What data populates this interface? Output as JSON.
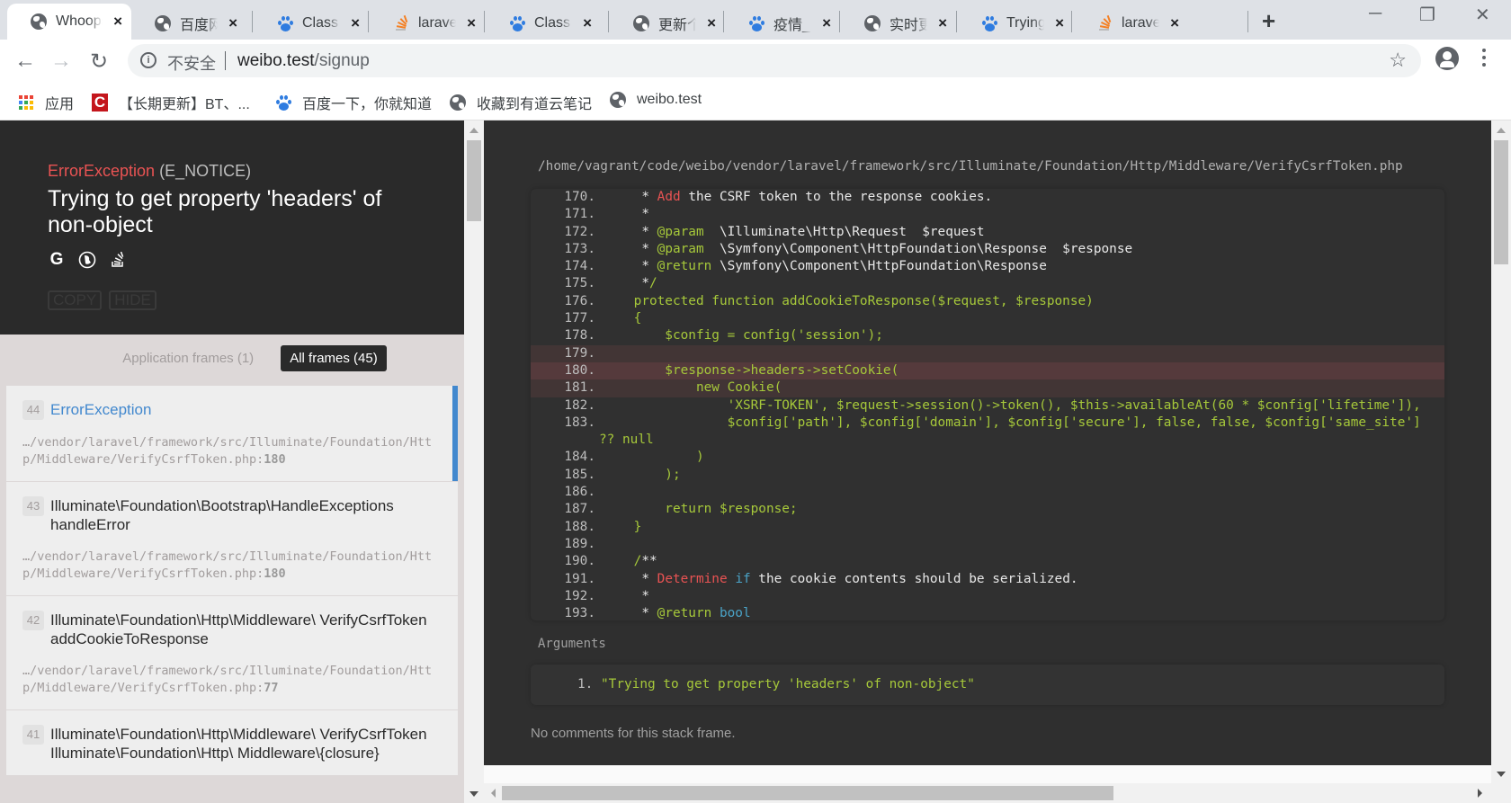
{
  "browser": {
    "tabs": [
      {
        "title": "Whoops! There was an error.",
        "favicon": "globe-icon",
        "active": true
      },
      {
        "title": "百度网盘",
        "favicon": "globe-icon",
        "active": false
      },
      {
        "title": "Class 'A",
        "favicon": "baidu-paw-icon",
        "active": false
      },
      {
        "title": "laravel",
        "favicon": "stackoverflow-icon",
        "active": false
      },
      {
        "title": "Class 'A",
        "favicon": "baidu-paw-icon",
        "active": false
      },
      {
        "title": "更新个人",
        "favicon": "globe-icon",
        "active": false
      },
      {
        "title": "疫情_百",
        "favicon": "baidu-paw-icon",
        "active": false
      },
      {
        "title": "实时更新",
        "favicon": "globe-icon",
        "active": false
      },
      {
        "title": "Trying",
        "favicon": "baidu-paw-icon",
        "active": false
      },
      {
        "title": "laravel",
        "favicon": "stackoverflow-icon",
        "active": false
      }
    ],
    "tab_close": "×",
    "new_tab": "+",
    "window_controls": {
      "minimize": "─",
      "restore": "❐",
      "close": "✕"
    },
    "nav": {
      "back": "←",
      "forward": "→",
      "reload": "↻"
    },
    "omnibox": {
      "security_label": "不安全",
      "host": "weibo.test",
      "path": "/signup",
      "info_glyph": "i"
    },
    "star": "☆",
    "bookmarks": [
      {
        "label": "应用",
        "icon": "apps-grid-icon"
      },
      {
        "label": "【长期更新】BT、...",
        "icon": "c-logo-icon"
      },
      {
        "label": "百度一下，你就知道",
        "icon": "baidu-paw-icon"
      },
      {
        "label": "收藏到有道云笔记",
        "icon": "globe-icon"
      },
      {
        "label": "weibo.test",
        "icon": "globe-icon"
      }
    ]
  },
  "whoops": {
    "exception_class": "ErrorException",
    "exception_code": "(E_NOTICE)",
    "message": "Trying to get property 'headers' of non-object",
    "search_links": [
      {
        "name": "google-search-icon",
        "glyph": "G"
      },
      {
        "name": "duckduckgo-search-icon",
        "glyph": "◐"
      },
      {
        "name": "stackoverflow-search-icon",
        "glyph": "≋"
      }
    ],
    "actions": {
      "copy": "COPY",
      "hide": "HIDE"
    },
    "filters": {
      "application": "Application frames (1)",
      "all": "All frames (45)"
    },
    "frames": [
      {
        "index": "44",
        "class": "ErrorException",
        "file": "…/vendor/laravel/framework/src/Illuminate/Foundation/Http/Middleware/VerifyCsrfToken.php",
        "line": "180",
        "active": true
      },
      {
        "index": "43",
        "class": "Illuminate\\Foundation\\Bootstrap\\HandleExceptions handleError",
        "file": "…/vendor/laravel/framework/src/Illuminate/Foundation/Http/Middleware/VerifyCsrfToken.php",
        "line": "180",
        "active": false
      },
      {
        "index": "42",
        "class": "Illuminate\\Foundation\\Http\\Middleware\\ VerifyCsrfToken addCookieToResponse",
        "file": "…/vendor/laravel/framework/src/Illuminate/Foundation/Http/Middleware/VerifyCsrfToken.php",
        "line": "77",
        "active": false
      },
      {
        "index": "41",
        "class": "Illuminate\\Foundation\\Http\\Middleware\\ VerifyCsrfToken Illuminate\\Foundation\\Http\\ Middleware\\{closure}",
        "file": "",
        "line": "",
        "active": false
      }
    ],
    "file_path": "/home/vagrant/code/weibo/vendor/laravel/framework/src/Illuminate/Foundation/Http/Middleware/VerifyCsrfToken.php",
    "code": [
      {
        "n": "170.",
        "t": "     * Add the CSRF token to the response cookies.",
        "style": "doc-add"
      },
      {
        "n": "171.",
        "t": "     *",
        "style": "doc"
      },
      {
        "n": "172.",
        "t": "     * @param  \\Illuminate\\Http\\Request  $request",
        "style": "doc-at",
        "at": "@param"
      },
      {
        "n": "173.",
        "t": "     * @param  \\Symfony\\Component\\HttpFoundation\\Response  $response",
        "style": "doc-at",
        "at": "@param"
      },
      {
        "n": "174.",
        "t": "     * @return \\Symfony\\Component\\HttpFoundation\\Response",
        "style": "doc-at",
        "at": "@return"
      },
      {
        "n": "175.",
        "t": "     */",
        "style": "doc-end"
      },
      {
        "n": "176.",
        "t": "    protected function addCookieToResponse($request, $response)",
        "style": "code"
      },
      {
        "n": "177.",
        "t": "    {",
        "style": "code"
      },
      {
        "n": "178.",
        "t": "        $config = config('session');",
        "style": "code"
      },
      {
        "n": "179.",
        "t": "",
        "style": "code",
        "hl": "near"
      },
      {
        "n": "180.",
        "t": "        $response->headers->setCookie(",
        "style": "code",
        "hl": "main"
      },
      {
        "n": "181.",
        "t": "            new Cookie(",
        "style": "code",
        "hl": "near"
      },
      {
        "n": "182.",
        "t": "                'XSRF-TOKEN', $request->session()->token(), $this->availableAt(60 * $config['lifetime']),",
        "style": "code"
      },
      {
        "n": "183.",
        "t": "                $config['path'], $config['domain'], $config['secure'], false, false, $config['same_site']",
        "style": "code"
      },
      {
        "n": "",
        "t": "?? null",
        "style": "code-wrap"
      },
      {
        "n": "184.",
        "t": "            )",
        "style": "code"
      },
      {
        "n": "185.",
        "t": "        );",
        "style": "code"
      },
      {
        "n": "186.",
        "t": "",
        "style": "code"
      },
      {
        "n": "187.",
        "t": "        return $response;",
        "style": "code"
      },
      {
        "n": "188.",
        "t": "    }",
        "style": "code"
      },
      {
        "n": "189.",
        "t": "",
        "style": "code"
      },
      {
        "n": "190.",
        "t": "    /**",
        "style": "doc-start"
      },
      {
        "n": "191.",
        "t": "     * Determine if the cookie contents should be serialized.",
        "style": "doc-determine"
      },
      {
        "n": "192.",
        "t": "     *",
        "style": "doc"
      },
      {
        "n": "193.",
        "t": "     * @return bool",
        "style": "doc-return-bool"
      }
    ],
    "arguments_label": "Arguments",
    "arguments": [
      {
        "n": "1.",
        "value": "\"Trying to get property 'headers' of non-object\""
      }
    ],
    "comments": "No comments for this stack frame."
  },
  "colors": {
    "accent_blue": "#4288ce",
    "error_red": "#e95353",
    "code_green": "#a6c83a",
    "highlight_line": "#553a3c"
  }
}
